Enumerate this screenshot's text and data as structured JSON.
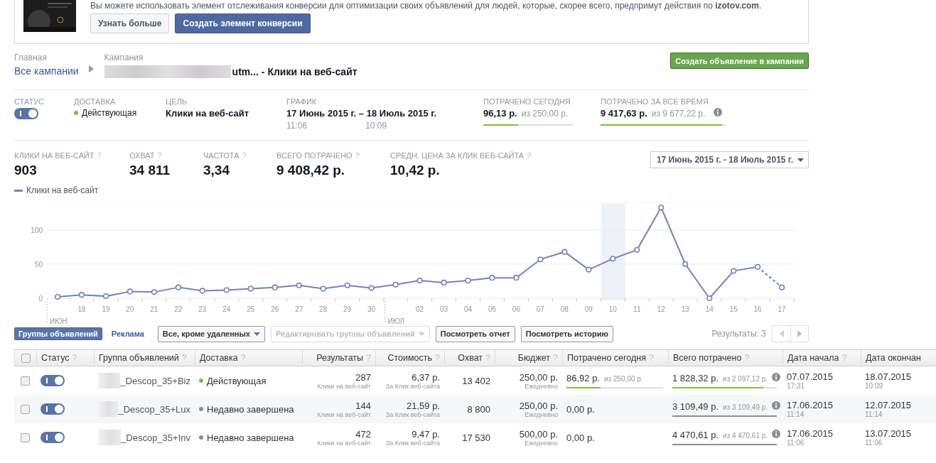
{
  "conversion_card": {
    "text": "Вы можете использовать элемент отслеживания конверсии для оптимизации своих объявлений для людей, которые, скорее всего, предпримут действия по **izotov.com**.",
    "buttons": [
      {
        "label": "Узнать больше",
        "kind": "secondary"
      },
      {
        "label": "Создать элемент конверсии",
        "kind": "primary"
      }
    ]
  },
  "breadcrumb": {
    "home_label": "Главная",
    "home_link": "Все кампании",
    "campaign_label": "Кампания",
    "campaign_name": "utm... - Клики на веб-сайт"
  },
  "create_ad_button": "Создать объявление в кампании",
  "summary": {
    "status": {
      "label": "СТАТУС",
      "on": true
    },
    "delivery": {
      "label": "ДОСТАВКА",
      "value": "Действующая",
      "color": "#7bc043"
    },
    "goal": {
      "label": "ЦЕЛЬ",
      "value": "Клики на веб-сайт"
    },
    "schedule": {
      "label": "ГРАФИК",
      "start": "17 Июнь 2015 г.",
      "separator": "–",
      "end": "18 Июль 2015 г.",
      "start_time": "11:06",
      "end_time": "10:09"
    },
    "spent_today": {
      "label": "ПОТРАЧЕНО СЕГОДНЯ",
      "value": "96,13 р.",
      "of": "из 250,00 р.",
      "level": 0.385
    },
    "spent_total": {
      "label": "ПОТРАЧЕНО ЗА ВСЕ ВРЕМЯ",
      "value": "9 417,63 р.",
      "of": "из 9 677,22 р.",
      "level": 0.973
    }
  },
  "metrics": [
    {
      "label": "КЛИКИ НА ВЕБ-САЙТ",
      "help": "?",
      "value": "903"
    },
    {
      "label": "ОХВАТ",
      "help": "?",
      "value": "34 811"
    },
    {
      "label": "ЧАСТОТА",
      "help": "?",
      "value": "3,34"
    },
    {
      "label": "ВСЕГО ПОТРАЧЕНО",
      "help": "?",
      "value": "9 408,42 р."
    },
    {
      "label": "СРЕДН. ЦЕНА ЗА КЛИК ВЕБ-САЙТА",
      "help": "?",
      "value": "10,42 р."
    }
  ],
  "date_range": "17 Июнь 2015 г. - 18 Июль 2015 г.",
  "chart": {
    "chart_data": {
      "type": "line",
      "categories": [
        null,
        "18",
        "19",
        "20",
        "21",
        "22",
        "23",
        "24",
        "25",
        "26",
        "27",
        "28",
        "29",
        "30",
        null,
        "02",
        "03",
        "04",
        "05",
        "06",
        "07",
        "08",
        "09",
        "10",
        "11",
        "12",
        "13",
        "14",
        "15",
        "16",
        "17"
      ],
      "series": [
        {
          "name": "Клики на веб-сайт",
          "color": "#7185b8",
          "marker": "o",
          "values": [
            2,
            5,
            3,
            10,
            9,
            16,
            11,
            12,
            14,
            16,
            19,
            14,
            19,
            15,
            20,
            26,
            23,
            26,
            30,
            30,
            57,
            68,
            42,
            58,
            71,
            133,
            50,
            0,
            40,
            46,
            16
          ]
        }
      ],
      "yticks": [
        0,
        50,
        100
      ],
      "ylim": [
        0,
        140
      ],
      "annotations": [
        {
          "text": "ИЮН"
        },
        {
          "text": "ИЮЛ"
        }
      ]
    }
  },
  "toolbar": {
    "tabs": [
      {
        "label": "Группы объявлений",
        "selected": true
      },
      {
        "label": "Реклама",
        "selected": false
      }
    ],
    "filter": "Все, кроме удаленных",
    "edit": {
      "label": "Редактировать группы объявлений",
      "disabled": true
    },
    "buttons": [
      "Посмотреть отчет",
      "Посмотреть историю"
    ],
    "results": "Результаты: 3"
  },
  "table": {
    "header_checked": false,
    "columns": [
      {
        "label": "Статус",
        "help": "?"
      },
      {
        "label": "Группа объявлений",
        "help": "?"
      },
      {
        "label": "Доставка",
        "help": "?"
      },
      {
        "label": "Результаты",
        "help": "?"
      },
      {
        "label": "Стоимость",
        "help": "?"
      },
      {
        "label": "Охват",
        "help": "?"
      },
      {
        "label": "Бюджет",
        "help": "?"
      },
      {
        "label": "Потрачено сегодня",
        "help": "?"
      },
      {
        "label": "Всего потрачено",
        "help": "?"
      },
      {
        "label": "Дата начала",
        "help": "?"
      },
      {
        "label": "Дата окончан"
      }
    ],
    "rows": [
      {
        "checked": false,
        "on": true,
        "name": "_Descop_35+Biz",
        "delivery": {
          "text": "Действующая",
          "color": "#7bc043"
        },
        "results": "287",
        "results_sub": "Клики на веб-сайт",
        "cost": "6,37 р.",
        "cost_sub": "За Клик веб-сайта",
        "reach": "13 402",
        "budget": "250,00 р.",
        "budget_sub": "Ежедневно",
        "spent_today": {
          "value": "86,92 р.",
          "of": "из 250,00 р.",
          "level": 0.35
        },
        "spent_total": {
          "value": "1 828,32 р.",
          "of": "из 2 097,12 р.",
          "level": 0.87
        },
        "start_date": "07.07.2015",
        "start_time": "17:31",
        "end_date": "18.07.2015",
        "end_time": "10:09"
      },
      {
        "checked": false,
        "on": true,
        "name": "_Descop_35+Lux",
        "delivery": {
          "text": "Недавно завершена",
          "color": "#8f8f8f"
        },
        "results": "144",
        "results_sub": "Клики на веб-сайт",
        "cost": "21,59 р.",
        "cost_sub": "За Клик веб-сайта",
        "reach": "8 800",
        "budget": "250,00 р.",
        "budget_sub": "Ежедневно",
        "spent_today": {
          "value": "0,00 р."
        },
        "spent_total": {
          "value": "3 109,49 р.",
          "of": "из 3 109,49 р."
        },
        "start_date": "17.06.2015",
        "start_time": "11:14",
        "end_date": "12.07.2015",
        "end_time": "11:14"
      },
      {
        "checked": false,
        "on": true,
        "name": "_Descop_35+Inv",
        "delivery": {
          "text": "Недавно завершена",
          "color": "#8f8f8f"
        },
        "results": "472",
        "results_sub": "Клики на веб-сайт",
        "cost": "9,47 р.",
        "cost_sub": "За Клик веб-сайта",
        "reach": "17 530",
        "budget": "500,00 р.",
        "budget_sub": "Ежедневно",
        "spent_today": {
          "value": "0,00 р."
        },
        "spent_total": {
          "value": "4 470,61 р.",
          "of": "из 4 470,61 р."
        },
        "start_date": "17.06.2015",
        "start_time": "11:06",
        "end_date": "13.07.2015",
        "end_time": "11:06"
      }
    ]
  }
}
